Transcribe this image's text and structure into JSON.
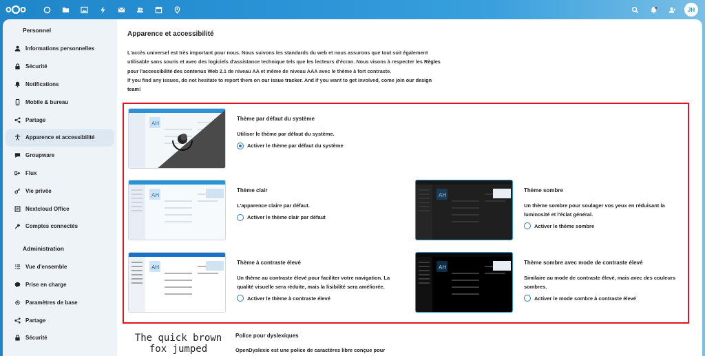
{
  "header": {
    "apps": [
      {
        "name": "dashboard-icon"
      },
      {
        "name": "files-icon"
      },
      {
        "name": "photos-icon"
      },
      {
        "name": "activity-icon"
      },
      {
        "name": "mail-icon"
      },
      {
        "name": "contacts-icon"
      },
      {
        "name": "calendar-icon"
      },
      {
        "name": "maps-icon"
      }
    ],
    "avatar_initials": "JH"
  },
  "sidebar": {
    "personal_heading": "Personnel",
    "personal_items": [
      {
        "label": "Informations personnelles",
        "icon": "user-icon"
      },
      {
        "label": "Sécurité",
        "icon": "lock-icon"
      },
      {
        "label": "Notifications",
        "icon": "bell-icon"
      },
      {
        "label": "Mobile & bureau",
        "icon": "phone-icon"
      },
      {
        "label": "Partage",
        "icon": "share-icon"
      },
      {
        "label": "Apparence et accessibilité",
        "icon": "accessibility-icon"
      },
      {
        "label": "Groupware",
        "icon": "groupware-icon"
      },
      {
        "label": "Flux",
        "icon": "flow-icon"
      },
      {
        "label": "Vie privée",
        "icon": "key-icon"
      },
      {
        "label": "Nextcloud Office",
        "icon": "office-icon"
      },
      {
        "label": "Comptes connectés",
        "icon": "wrench-icon"
      }
    ],
    "admin_heading": "Administration",
    "admin_items": [
      {
        "label": "Vue d'ensemble",
        "icon": "list-icon"
      },
      {
        "label": "Prise en charge",
        "icon": "chat-icon"
      },
      {
        "label": "Paramètres de base",
        "icon": "settings-icon"
      },
      {
        "label": "Partage",
        "icon": "share-icon"
      },
      {
        "label": "Sécurité",
        "icon": "lock-icon"
      }
    ]
  },
  "main": {
    "title": "Apparence et accessibilité",
    "desc_p1": "L'accès universel est très important pour nous. Nous suivons les standards du web et nous assurons que tout soit également utilisable sans souris et avec des logiciels d'assistance technique tels que les lecteurs d'écran. Nous visons à respecter les ",
    "desc_p1_link": "Règles pour l'accessibilité des contenus Web",
    "desc_p1_end": " 2.1 de niveau AA et même de niveau AAA avec le thème à fort contraste.",
    "desc_p2": "If you find any issues, do not hesitate to report them on ",
    "desc_p2_link": "our issue tracker",
    "desc_p2_mid": ". And if you want to get involved, come join ",
    "desc_p2_link2": "our design team",
    "desc_p2_end": "!",
    "preview_initials": "AH",
    "themes": {
      "default": {
        "name": "Thème par défaut du système",
        "desc": "Utiliser le thème par défaut du système.",
        "option": "Activer le thème par défaut du système",
        "checked": true
      },
      "light": {
        "name": "Thème clair",
        "desc": "L'apparence claire par défaut.",
        "option": "Activer le thème clair par défaut",
        "checked": false
      },
      "dark": {
        "name": "Thème sombre",
        "desc": "Un thème sombre pour soulager vos yeux en réduisant la luminosité et l'éclat général.",
        "option": "Activer le thème sombre",
        "checked": false
      },
      "hc": {
        "name": "Thème à contraste élevé",
        "desc": "Un thème au contraste élevé pour faciliter votre navigation. La qualité visuelle sera réduite, mais la lisibilité sera améliorée.",
        "option": "Activer le thème à contraste élevé",
        "checked": false
      },
      "darkhc": {
        "name": "Thème sombre avec mode de contraste élevé",
        "desc": "Similaire au mode de contraste élevé, mais avec des couleurs sombres.",
        "option": "Activer le mode sombre à contraste élevé",
        "checked": false
      }
    },
    "font": {
      "preview_text": "The quick brown fox jumped",
      "title": "Police pour dyslexiques",
      "desc": "OpenDyslexic est une police de caractères libre conçue pour"
    }
  },
  "colors": {
    "primary": "#2a93d6",
    "highlight_border": "#e0141e"
  }
}
